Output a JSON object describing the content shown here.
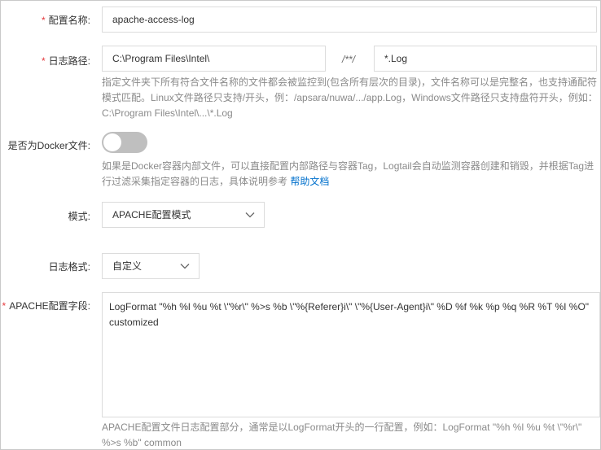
{
  "config_name": {
    "label": "配置名称:",
    "value": "apache-access-log"
  },
  "log_path": {
    "label": "日志路径:",
    "dir_value": "C:\\Program Files\\Intel\\",
    "separator": "/**/",
    "file_value": "*.Log",
    "help": "指定文件夹下所有符合文件名称的文件都会被监控到(包含所有层次的目录)，文件名称可以是完整名，也支持通配符模式匹配。Linux文件路径只支持/开头，例：/apsara/nuwa/.../app.Log，Windows文件路径只支持盘符开头，例如：C:\\Program Files\\Intel\\...\\*.Log"
  },
  "docker": {
    "label": "是否为Docker文件:",
    "enabled": false,
    "help": "如果是Docker容器内部文件，可以直接配置内部路径与容器Tag，Logtail会自动监测容器创建和销毁，并根据Tag进行过滤采集指定容器的日志，具体说明参考",
    "help_link": "帮助文档"
  },
  "mode": {
    "label": "模式:",
    "value": "APACHE配置模式"
  },
  "log_format": {
    "label": "日志格式:",
    "value": "自定义"
  },
  "apache_field": {
    "label": "APACHE配置字段:",
    "value": "LogFormat \"%h %l %u %t \\\"%r\\\" %>s %b \\\"%{Referer}i\\\" \\\"%{User-Agent}i\\\" %D %f %k %p %q %R %T %I %O\" customized",
    "help": "APACHE配置文件日志配置部分，通常是以LogFormat开头的一行配置，例如：LogFormat \"%h %l %u %t \\\"%r\\\" %>s %b\" common"
  },
  "colors": {
    "required": "#e4393c",
    "link": "#0070cc",
    "help_text": "#8a8a8a",
    "border": "#dcdcdc",
    "toggle_off": "#bfbfbf"
  },
  "icons": {
    "dropdown": "chevron-down-icon"
  }
}
